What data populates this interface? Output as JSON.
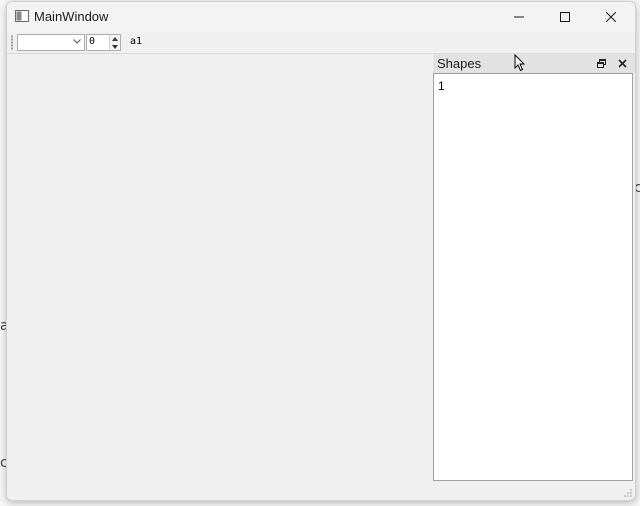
{
  "window": {
    "title": "MainWindow"
  },
  "toolbar": {
    "combo_value": "",
    "spin_value": "0",
    "label": "a1"
  },
  "dock": {
    "title": "Shapes",
    "items": [
      "1"
    ]
  },
  "icons": {
    "minimize": "minimize-icon",
    "maximize": "maximize-icon",
    "close": "close-icon",
    "dock_float": "restore-icon",
    "dock_close": "close-icon"
  },
  "colors": {
    "window_bg": "#f0f0f0",
    "dock_title_bg": "#e2e2e2",
    "list_bg": "#ffffff"
  }
}
